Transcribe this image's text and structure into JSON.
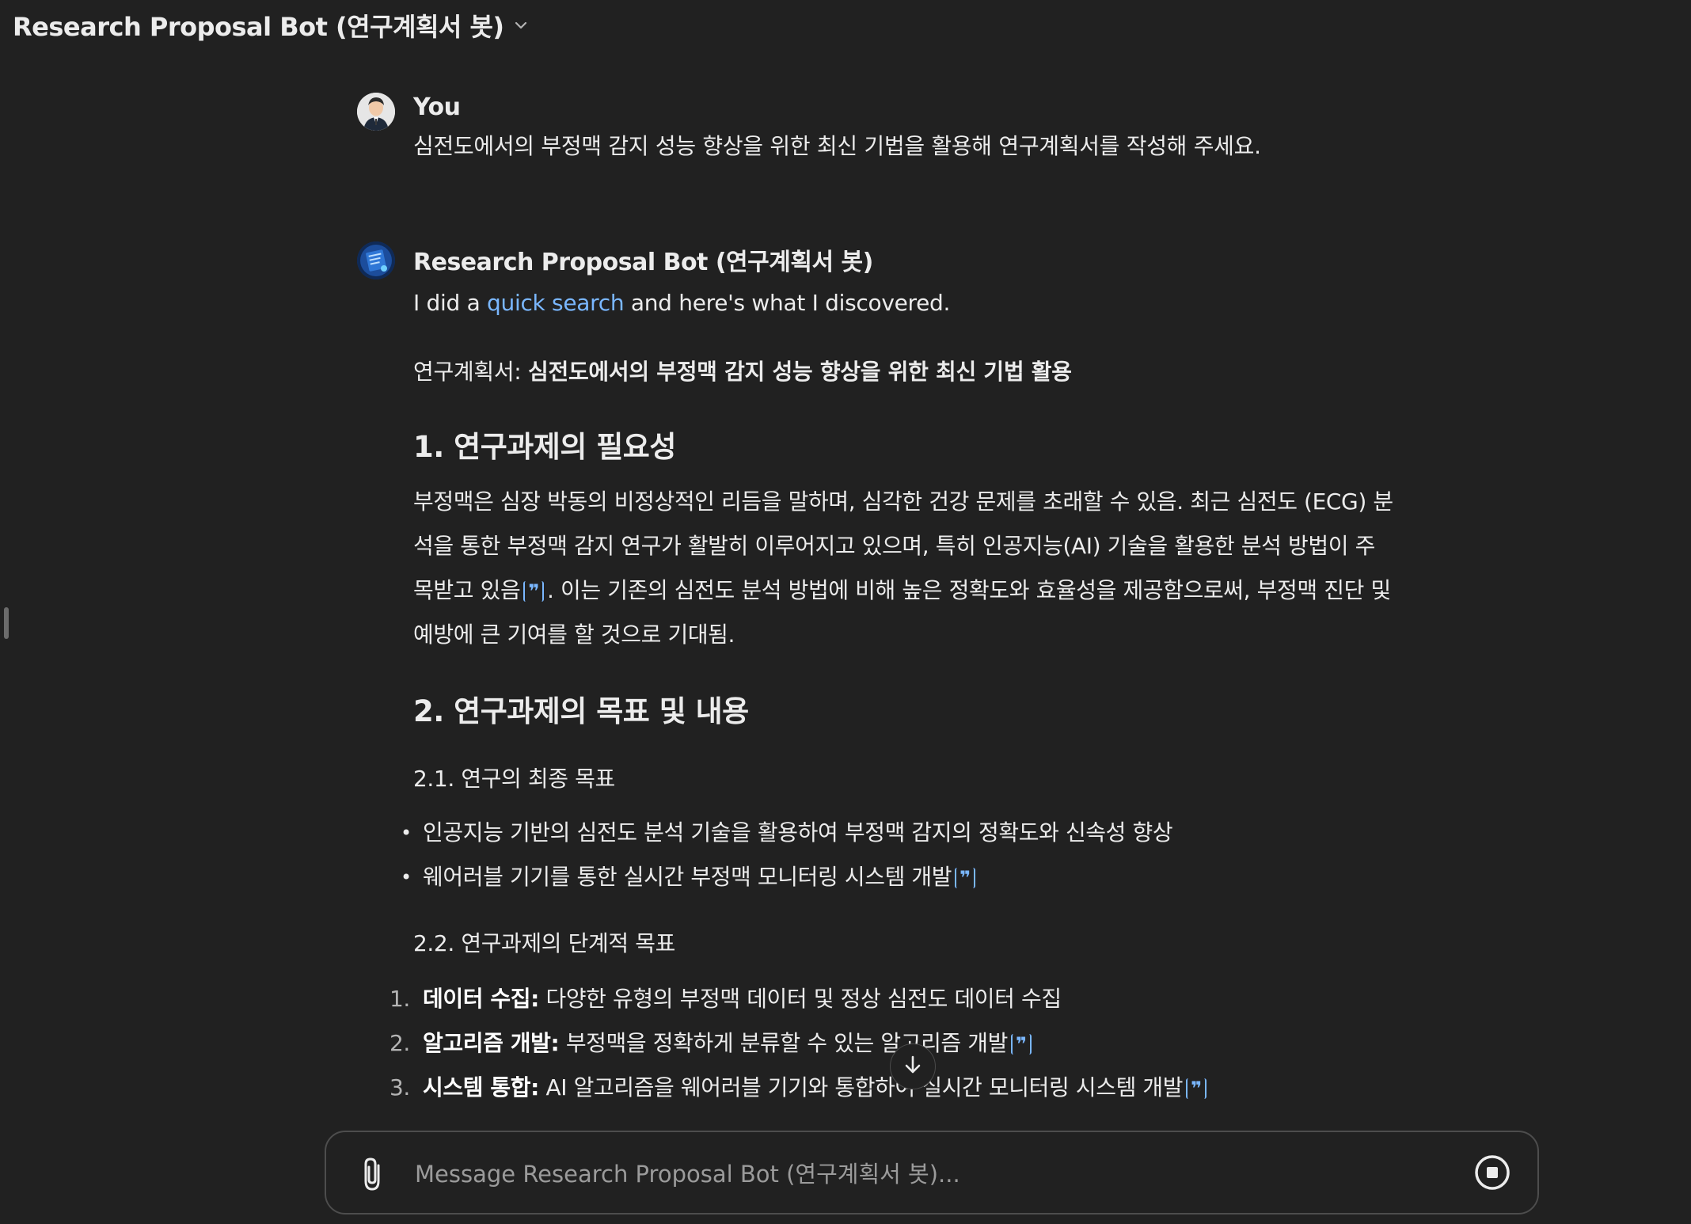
{
  "header": {
    "title": "Research Proposal Bot (연구계획서 봇)",
    "dropdown_icon": "chevron-down-icon"
  },
  "user_message": {
    "sender": "You",
    "text": "심전도에서의 부정맥 감지 성능 향상을 위한 최신 기법을 활용해 연구계획서를 작성해 주세요."
  },
  "bot_message": {
    "sender": "Research Proposal Bot (연구계획서 봇)",
    "intro_before": "I did a ",
    "intro_link": "quick search",
    "intro_after": " and here's what I discovered.",
    "proposal_prefix": "연구계획서: ",
    "proposal_title": "심전도에서의 부정맥 감지 성능 향상을 위한 최신 기법 활용",
    "section1": {
      "heading": "1. 연구과제의 필요성",
      "para_a": "부정맥은 심장 박동의 비정상적인 리듬을 말하며, 심각한 건강 문제를 초래할 수 있음. 최근 심전도 (ECG) 분석을 통한 부정맥 감지 연구가 활발히 이루어지고 있으며, 특히 인공지능(AI) 기술을 활용한 분석 방법이 주목받고 있음",
      "para_b": ". 이는 기존의 심전도 분석 방법에 비해 높은 정확도와 효율성을 제공함으로써, 부정맥 진단 및 예방에 큰 기여를 할 것으로 기대됨."
    },
    "section2": {
      "heading": "2. 연구과제의 목표 및 내용",
      "sub1": "2.1. 연구의 최종 목표",
      "goals": [
        "인공지능 기반의 심전도 분석 기술을 활용하여 부정맥 감지의 정확도와 신속성 향상",
        "웨어러블 기기를 통한 실시간 부정맥 모니터링 시스템 개발"
      ],
      "sub2": "2.2. 연구과제의 단계적 목표",
      "steps": [
        {
          "num": "1.",
          "label": "데이터 수집:",
          "text": " 다양한 유형의 부정맥 데이터 및 정상 심전도 데이터 수집"
        },
        {
          "num": "2.",
          "label": "알고리즘 개발:",
          "text": " 부정맥을 정확하게 분류할 수 있는 알고리즘 개발"
        },
        {
          "num": "3.",
          "label": "시스템 통합:",
          "text": " AI 알고리즘을 웨어러블 기기와 통합하여 실시간 모니터링 시스템 개발"
        }
      ]
    },
    "citation_icon": "quote-citation-icon"
  },
  "composer": {
    "placeholder": "Message Research Proposal Bot (연구계획서 봇)...",
    "attach_icon": "paperclip-icon",
    "stop_icon": "stop-icon"
  },
  "scroll_down_icon": "arrow-down-icon"
}
